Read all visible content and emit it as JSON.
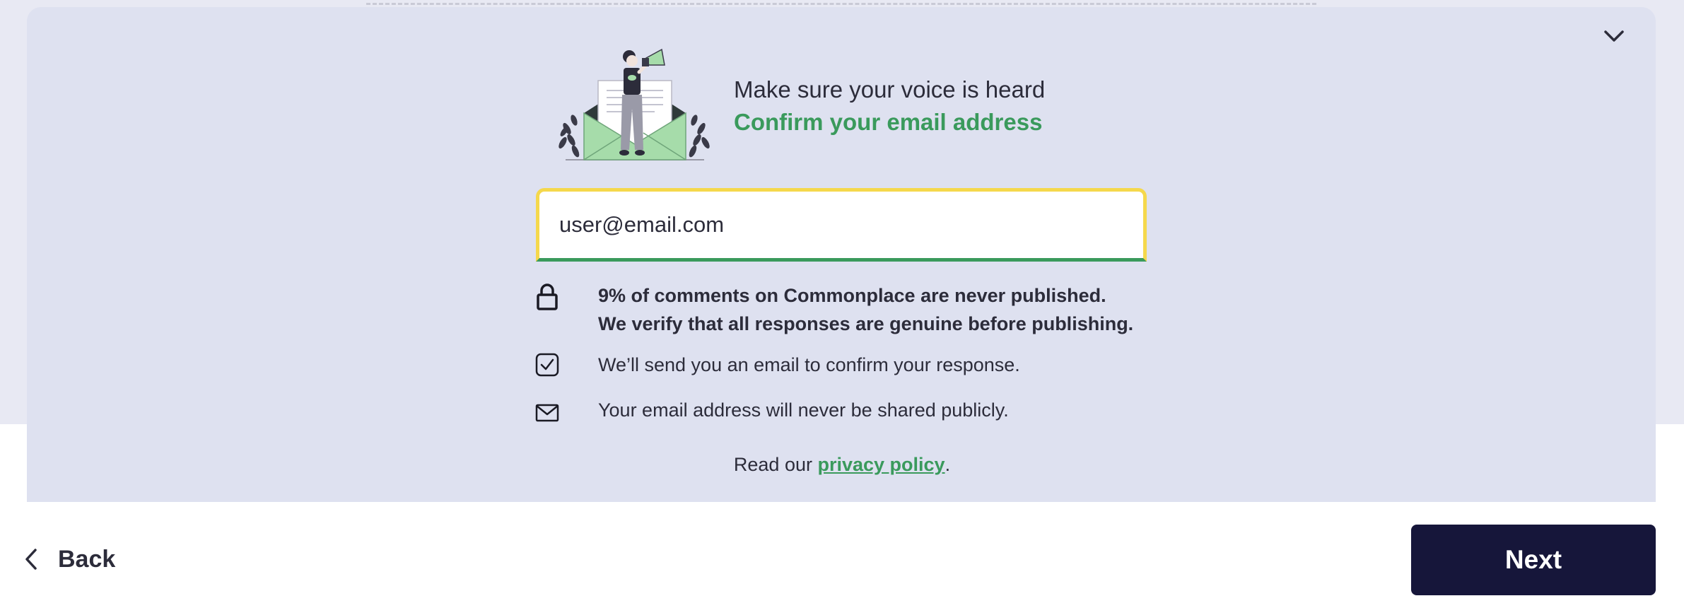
{
  "header": {
    "title": "Make sure your voice is heard",
    "subtitle": "Confirm your email address"
  },
  "email_field": {
    "value": "user@email.com"
  },
  "info": {
    "line1": "9% of comments on Commonplace are never published.",
    "line2": "We verify that all responses are genuine before publishing.",
    "confirm": "We’ll send you an email to confirm your response.",
    "privacy_note": "Your email address will never be shared publicly."
  },
  "privacy": {
    "prefix": "Read our ",
    "link_label": "privacy policy",
    "suffix": "."
  },
  "footer": {
    "back_label": "Back",
    "next_label": "Next"
  },
  "icons": {
    "collapse": "chevron-down-icon",
    "lock": "lock-icon",
    "check": "checkbox-icon",
    "mail": "mail-icon",
    "back": "chevron-left-icon"
  },
  "colors": {
    "accent_green": "#3a9a5c",
    "focus_yellow": "#f5d84c",
    "panel_bg": "#dee1f0",
    "button_dark": "#16163a"
  }
}
